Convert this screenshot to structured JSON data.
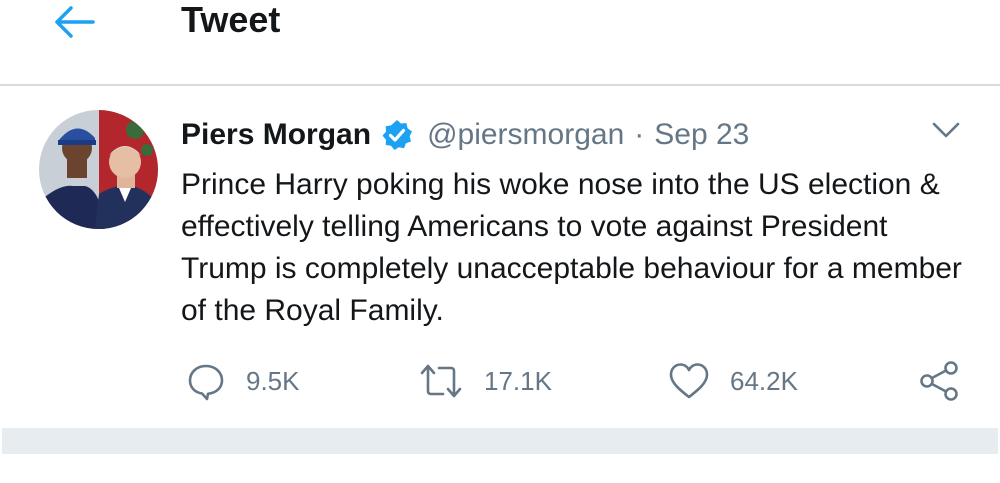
{
  "header": {
    "title": "Tweet"
  },
  "tweet": {
    "author_name": "Piers Morgan",
    "handle": "@piersmorgan",
    "separator": "·",
    "date": "Sep 23",
    "text": "Prince Harry poking his woke nose into the US election & effectively telling Americans to vote against President Trump is completely unacceptable behaviour for a member of the Royal Family.",
    "replies": "9.5K",
    "retweets": "17.1K",
    "likes": "64.2K"
  },
  "colors": {
    "accent": "#1da1f2",
    "muted": "#657786",
    "text": "#14171a",
    "divider": "#e6ecf0"
  },
  "icons": [
    "back-arrow-icon",
    "verified-badge-icon",
    "chevron-down-icon",
    "reply-icon",
    "retweet-icon",
    "like-icon",
    "share-icon"
  ]
}
